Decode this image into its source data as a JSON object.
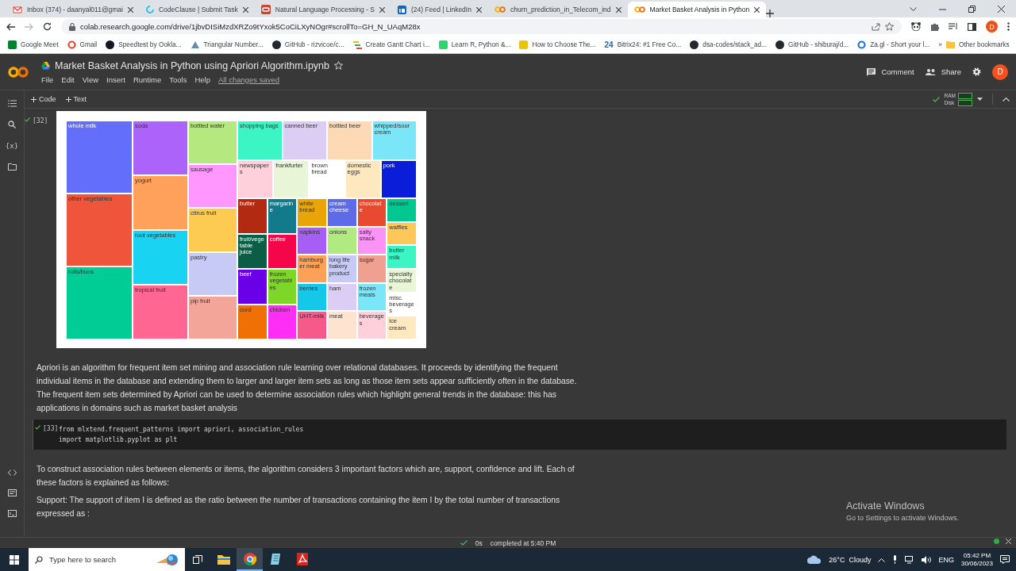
{
  "browser": {
    "tabs": [
      {
        "title": "Inbox (374) - daanyal011@gmai",
        "kind": "envelope",
        "selected": false
      },
      {
        "title": "CodeClause | Submit Task",
        "kind": "swirl",
        "selected": false
      },
      {
        "title": "Natural Language Processing - S",
        "kind": "oval",
        "selected": false
      },
      {
        "title": "(24) Feed | LinkedIn",
        "kind": "square",
        "selected": false
      },
      {
        "title": "churn_prediction_in_Telecom_ind",
        "kind": "rings",
        "selected": false
      },
      {
        "title": "Market Basket Analysis in Python",
        "kind": "rings",
        "selected": true
      }
    ],
    "forward_disabled": true,
    "address": "colab.research.google.com/drive/1jbvDISiMzdXRZo9tYxok5CoCiLXyNOgr#scrollTo=GH_N_UAqM28x",
    "profile": "D",
    "bookmarks": [
      {
        "label": "Google Meet",
        "kind": "square",
        "color": "#00832d"
      },
      {
        "label": "Gmail",
        "kind": "ring",
        "color": "#ea4335"
      },
      {
        "label": "Speedtest by Ookla...",
        "kind": "circle",
        "color": "#141526"
      },
      {
        "label": "Triangular Number...",
        "kind": "triangle",
        "color": "#6b8ab0"
      },
      {
        "label": "GitHub - rizvicoe/c...",
        "kind": "circle",
        "color": "#24292f"
      },
      {
        "label": "Create Gantt Chart i...",
        "kind": "bars",
        "color": "#f4b400"
      },
      {
        "label": "Learn R, Python &...",
        "kind": "square",
        "color": "#2bd66e"
      },
      {
        "label": "How to Choose The...",
        "kind": "square",
        "color": "#e8c40a"
      },
      {
        "label": "Bitrix24: #1 Free Co...",
        "kind": "number",
        "badge": "24",
        "color": "#2067b0"
      },
      {
        "label": "dsa-codes/stack_ad...",
        "kind": "circle",
        "color": "#24292f"
      },
      {
        "label": "GitHub - shiburaj/d...",
        "kind": "circle",
        "color": "#24292f"
      },
      {
        "label": "Za.gl - Short your l...",
        "kind": "ring",
        "color": "#1a73e8"
      }
    ],
    "more": "»",
    "other_bookmarks": "Other bookmarks"
  },
  "notebook": {
    "title": "Market Basket Analysis in Python using Apriori Algorithm.ipynb",
    "menu": [
      "File",
      "Edit",
      "View",
      "Insert",
      "Runtime",
      "Tools",
      "Help"
    ],
    "save_status": "All changes saved",
    "comment": "Comment",
    "share": "Share",
    "avatar": "D",
    "add_code": "Code",
    "add_text": "Text",
    "ram": "RAM",
    "disk": "Disk",
    "sidebar_glyph": "{x}"
  },
  "cells": [
    {
      "kind": "output",
      "label": "[32]",
      "treemap": {
        "columns": [
          {
            "tiles": [
              {
                "label": "whole milk",
                "color": "#636efa"
              },
              {
                "label": "other vegetables",
                "color": "#ef553b"
              },
              {
                "label": "rolls/buns",
                "color": "#00cc96"
              }
            ]
          },
          {
            "tiles": [
              {
                "label": "soda",
                "color": "#ab63fa"
              },
              {
                "label": "yogurt",
                "color": "#ffa15a"
              },
              {
                "label": "root vegetables",
                "color": "#19d3f3"
              },
              {
                "label": "tropical fruit",
                "color": "#ff6692"
              }
            ]
          },
          {
            "tiles": [
              {
                "label": "bottled water",
                "color": "#b6e880"
              },
              {
                "label": "sausage",
                "color": "#ff97ff"
              },
              {
                "label": "citrus fruit",
                "color": "#fecb52"
              },
              {
                "label": "pastry",
                "color": "#c6caf5"
              },
              {
                "label": "pip fruit",
                "color": "#f4a59a"
              }
            ]
          },
          {
            "rows": [
              {
                "tiles": [
                  {
                    "label": "shopping bags",
                    "color": "#3cf5c4"
                  },
                  {
                    "label": "canned beer",
                    "color": "#dccdf5"
                  },
                  {
                    "label": "bottled beer",
                    "color": "#fdd9b5"
                  },
                  {
                    "label": "whipped/sour cream",
                    "color": "#7ae6f7"
                  }
                ]
              },
              {
                "tiles": [
                  {
                    "label": "newspapers",
                    "color": "#fdd0dc"
                  },
                  {
                    "label": "frankfurter",
                    "color": "#e8f5d6"
                  },
                  {
                    "label": "brown bread",
                    "color": "#ffffff"
                  },
                  {
                    "label": "domestic eggs",
                    "color": "#fde8c0"
                  },
                  {
                    "label": "pork",
                    "color": "#0a1ed9"
                  }
                ]
              },
              {
                "columns": [
                  {
                    "tiles": [
                      {
                        "label": "butter",
                        "color": "#b22a12"
                      },
                      {
                        "label": "fruit/vegetable juice",
                        "color": "#0b5e45"
                      },
                      {
                        "label": "beef",
                        "color": "#6a00e8"
                      },
                      {
                        "label": "curd",
                        "color": "#f07005"
                      }
                    ]
                  },
                  {
                    "tiles": [
                      {
                        "label": "margarine",
                        "color": "#127a8a"
                      },
                      {
                        "label": "coffee",
                        "color": "#f5054a"
                      },
                      {
                        "label": "frozen vegetables",
                        "color": "#7dd628"
                      },
                      {
                        "label": "chicken",
                        "color": "#ff2ef5"
                      }
                    ]
                  },
                  {
                    "tiles": [
                      {
                        "label": "white bread",
                        "color": "#e8a505"
                      },
                      {
                        "label": "napkins",
                        "color": "#a65ef5"
                      },
                      {
                        "label": "hamburger meat",
                        "color": "#fca157"
                      },
                      {
                        "label": "berries",
                        "color": "#15c7e8"
                      },
                      {
                        "label": "UHT-milk",
                        "color": "#f55a8a"
                      }
                    ]
                  },
                  {
                    "tiles": [
                      {
                        "label": "cream cheese",
                        "color": "#5e6be8"
                      },
                      {
                        "label": "onions",
                        "color": "#b0ea80"
                      },
                      {
                        "label": "long life bakery product",
                        "color": "#c6caf5"
                      },
                      {
                        "label": "ham",
                        "color": "#dccdf5"
                      },
                      {
                        "label": "meat",
                        "color": "#fde3d0"
                      }
                    ]
                  },
                  {
                    "tiles": [
                      {
                        "label": "chocolate",
                        "color": "#e84a30"
                      },
                      {
                        "label": "salty snack",
                        "color": "#fb92f5"
                      },
                      {
                        "label": "sugar",
                        "color": "#f0a090"
                      },
                      {
                        "label": "frozen meals",
                        "color": "#7ae6f7"
                      },
                      {
                        "label": "beverages",
                        "color": "#fdd0dc"
                      }
                    ]
                  },
                  {
                    "tiles": [
                      {
                        "label": "dessert",
                        "color": "#00c890"
                      },
                      {
                        "label": "waffles",
                        "color": "#fdc85a"
                      },
                      {
                        "label": "butter milk",
                        "color": "#3cf5c4"
                      },
                      {
                        "label": "specialty chocolate",
                        "color": "#e8f5d6"
                      },
                      {
                        "label": "misc. beverages",
                        "color": "#ffffff"
                      },
                      {
                        "label": "ice cream",
                        "color": "#fde8c0"
                      }
                    ]
                  }
                ]
              }
            ]
          }
        ]
      }
    },
    {
      "kind": "text",
      "paragraphs": [
        "Apriori is an algorithm for frequent item set mining and association rule learning over relational databases. It proceeds by identifying the frequent individual items in the database and extending them to larger and larger item sets as long as those item sets appear sufficiently often in the database. The frequent item sets determined by Apriori can be used to determine association rules which highlight general trends in the database: this has applications in domains such as market basket analysis"
      ]
    },
    {
      "kind": "code",
      "label": "[33]",
      "lines": [
        "from mlxtend.frequent_patterns import apriori, association_rules",
        "import matplotlib.pyplot as plt"
      ]
    },
    {
      "kind": "text",
      "paragraphs": [
        "To construct association rules between elements or items, the algorithm considers 3 important factors which are, support, confidence and lift. Each of these factors is explained as follows:",
        "Support: The support of item I is defined as the ratio between the number of transactions containing the item I by the total number of transactions expressed as :"
      ]
    }
  ],
  "status": {
    "duration": "0s",
    "message": "completed at 5:40 PM"
  },
  "activation": {
    "title": "Activate Windows",
    "subtitle": "Go to Settings to activate Windows."
  },
  "taskbar": {
    "search_placeholder": "Type here to search",
    "apps": [
      {
        "kind": "folder",
        "selected": false
      },
      {
        "kind": "browser",
        "selected": true
      },
      {
        "kind": "notepad",
        "selected": false
      },
      {
        "kind": "pdf",
        "selected": false
      }
    ],
    "weather": "26°C  Cloudy",
    "language": "ENG",
    "time": "05:42 PM",
    "date": "30/06/2023"
  }
}
